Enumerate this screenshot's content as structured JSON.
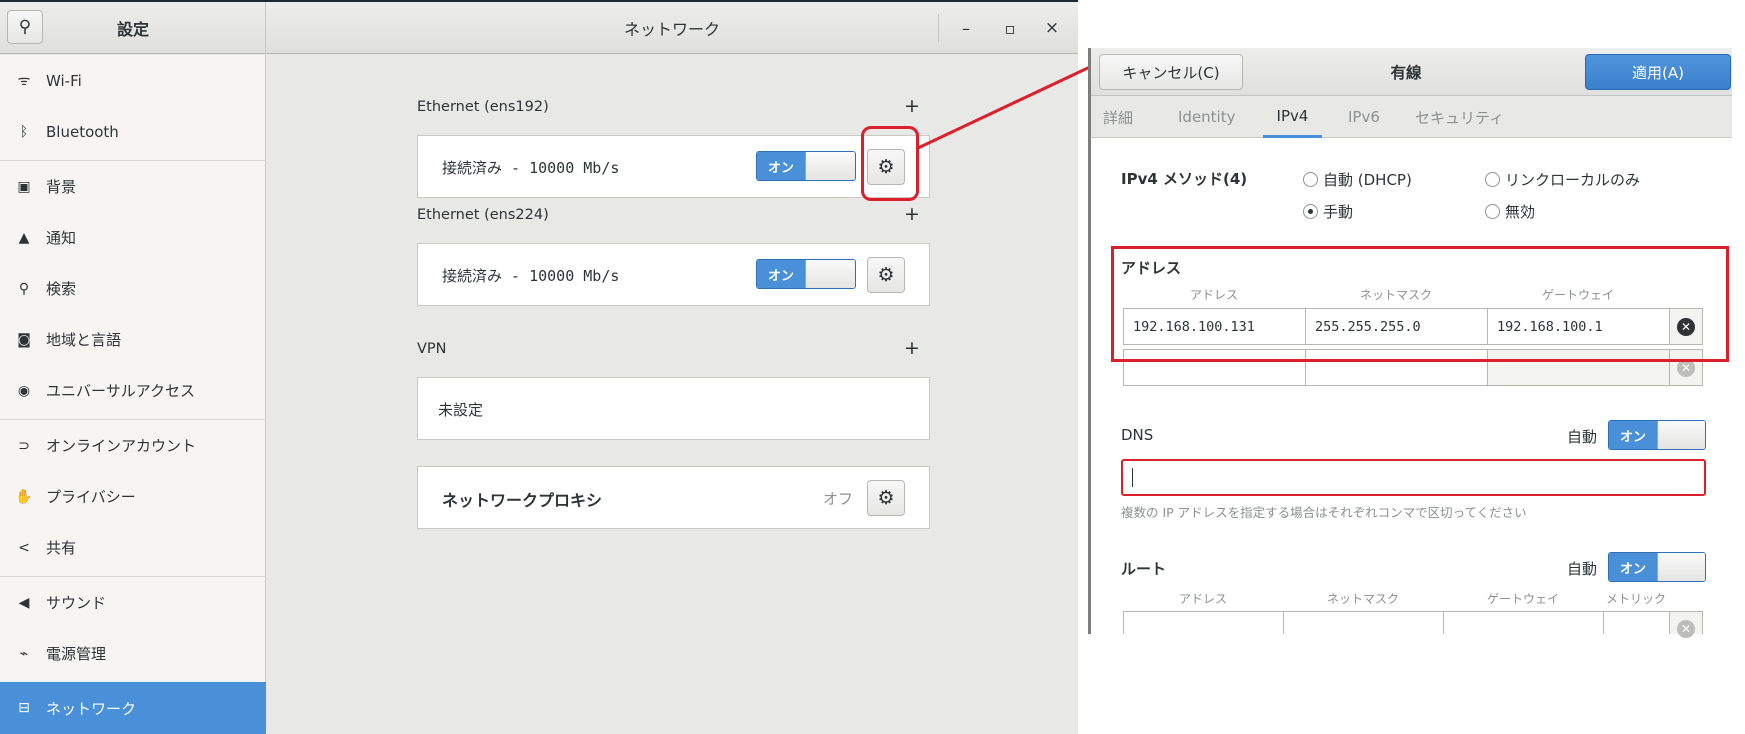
{
  "settings": {
    "search_icon": "search-icon",
    "title_left": "設定",
    "title_right": "ネットワーク",
    "window_controls": {
      "minimize": "–",
      "maximize": "▫",
      "close": "×"
    }
  },
  "sidebar": {
    "items": [
      {
        "label": "Wi-Fi",
        "icon": "wifi-icon",
        "glyph": "ᯤ"
      },
      {
        "label": "Bluetooth",
        "icon": "bluetooth-icon",
        "glyph": "ᛒ"
      },
      {
        "label": "背景",
        "icon": "background-icon",
        "glyph": "▣"
      },
      {
        "label": "通知",
        "icon": "bell-icon",
        "glyph": "▲"
      },
      {
        "label": "検索",
        "icon": "search-icon",
        "glyph": "⚲"
      },
      {
        "label": "地域と言語",
        "icon": "camera-icon",
        "glyph": "◙"
      },
      {
        "label": "ユニバーサルアクセス",
        "icon": "accessibility-icon",
        "glyph": "◉"
      },
      {
        "label": "オンラインアカウント",
        "icon": "online-accounts-icon",
        "glyph": "⊃"
      },
      {
        "label": "プライバシー",
        "icon": "hand-icon",
        "glyph": "✋"
      },
      {
        "label": "共有",
        "icon": "share-icon",
        "glyph": "<"
      },
      {
        "label": "サウンド",
        "icon": "speaker-icon",
        "glyph": "◀"
      },
      {
        "label": "電源管理",
        "icon": "power-icon",
        "glyph": "⌁"
      },
      {
        "label": "ネットワーク",
        "icon": "network-icon",
        "glyph": "⊟"
      }
    ],
    "selected_color": "#4a90d9"
  },
  "network": {
    "ethernet1": {
      "title": "Ethernet (ens192)",
      "status": "接続済み - 10000 Mb/s",
      "toggle": "オン"
    },
    "ethernet2": {
      "title": "Ethernet (ens224)",
      "status": "接続済み - 10000 Mb/s",
      "toggle": "オン"
    },
    "vpn": {
      "title": "VPN",
      "status": "未設定"
    },
    "proxy": {
      "label": "ネットワークプロキシ",
      "state": "オフ"
    },
    "add": "+"
  },
  "dialog": {
    "cancel": "キャンセル(C)",
    "title": "有線",
    "apply": "適用(A)",
    "tabs": [
      "詳細",
      "Identity",
      "IPv4",
      "IPv6",
      "セキュリティ"
    ],
    "method_label": "IPv4 メソッド(4)",
    "methods": [
      "自動 (DHCP)",
      "リンクローカルのみ",
      "手動",
      "無効"
    ],
    "address_section": "アドレス",
    "address_headers": [
      "アドレス",
      "ネットマスク",
      "ゲートウェイ"
    ],
    "address_row": [
      "192.168.100.131",
      "255.255.255.0",
      "192.168.100.1"
    ],
    "dns_label": "DNS",
    "auto_label": "自動",
    "toggle_on": "オン",
    "dns_hint": "複数の IP アドレスを指定する場合はそれぞれコンマで区切ってください",
    "route_label": "ルート",
    "route_headers": [
      "アドレス",
      "ネットマスク",
      "ゲートウェイ",
      "メトリック"
    ]
  },
  "highlight_color": "#dd1f2b"
}
